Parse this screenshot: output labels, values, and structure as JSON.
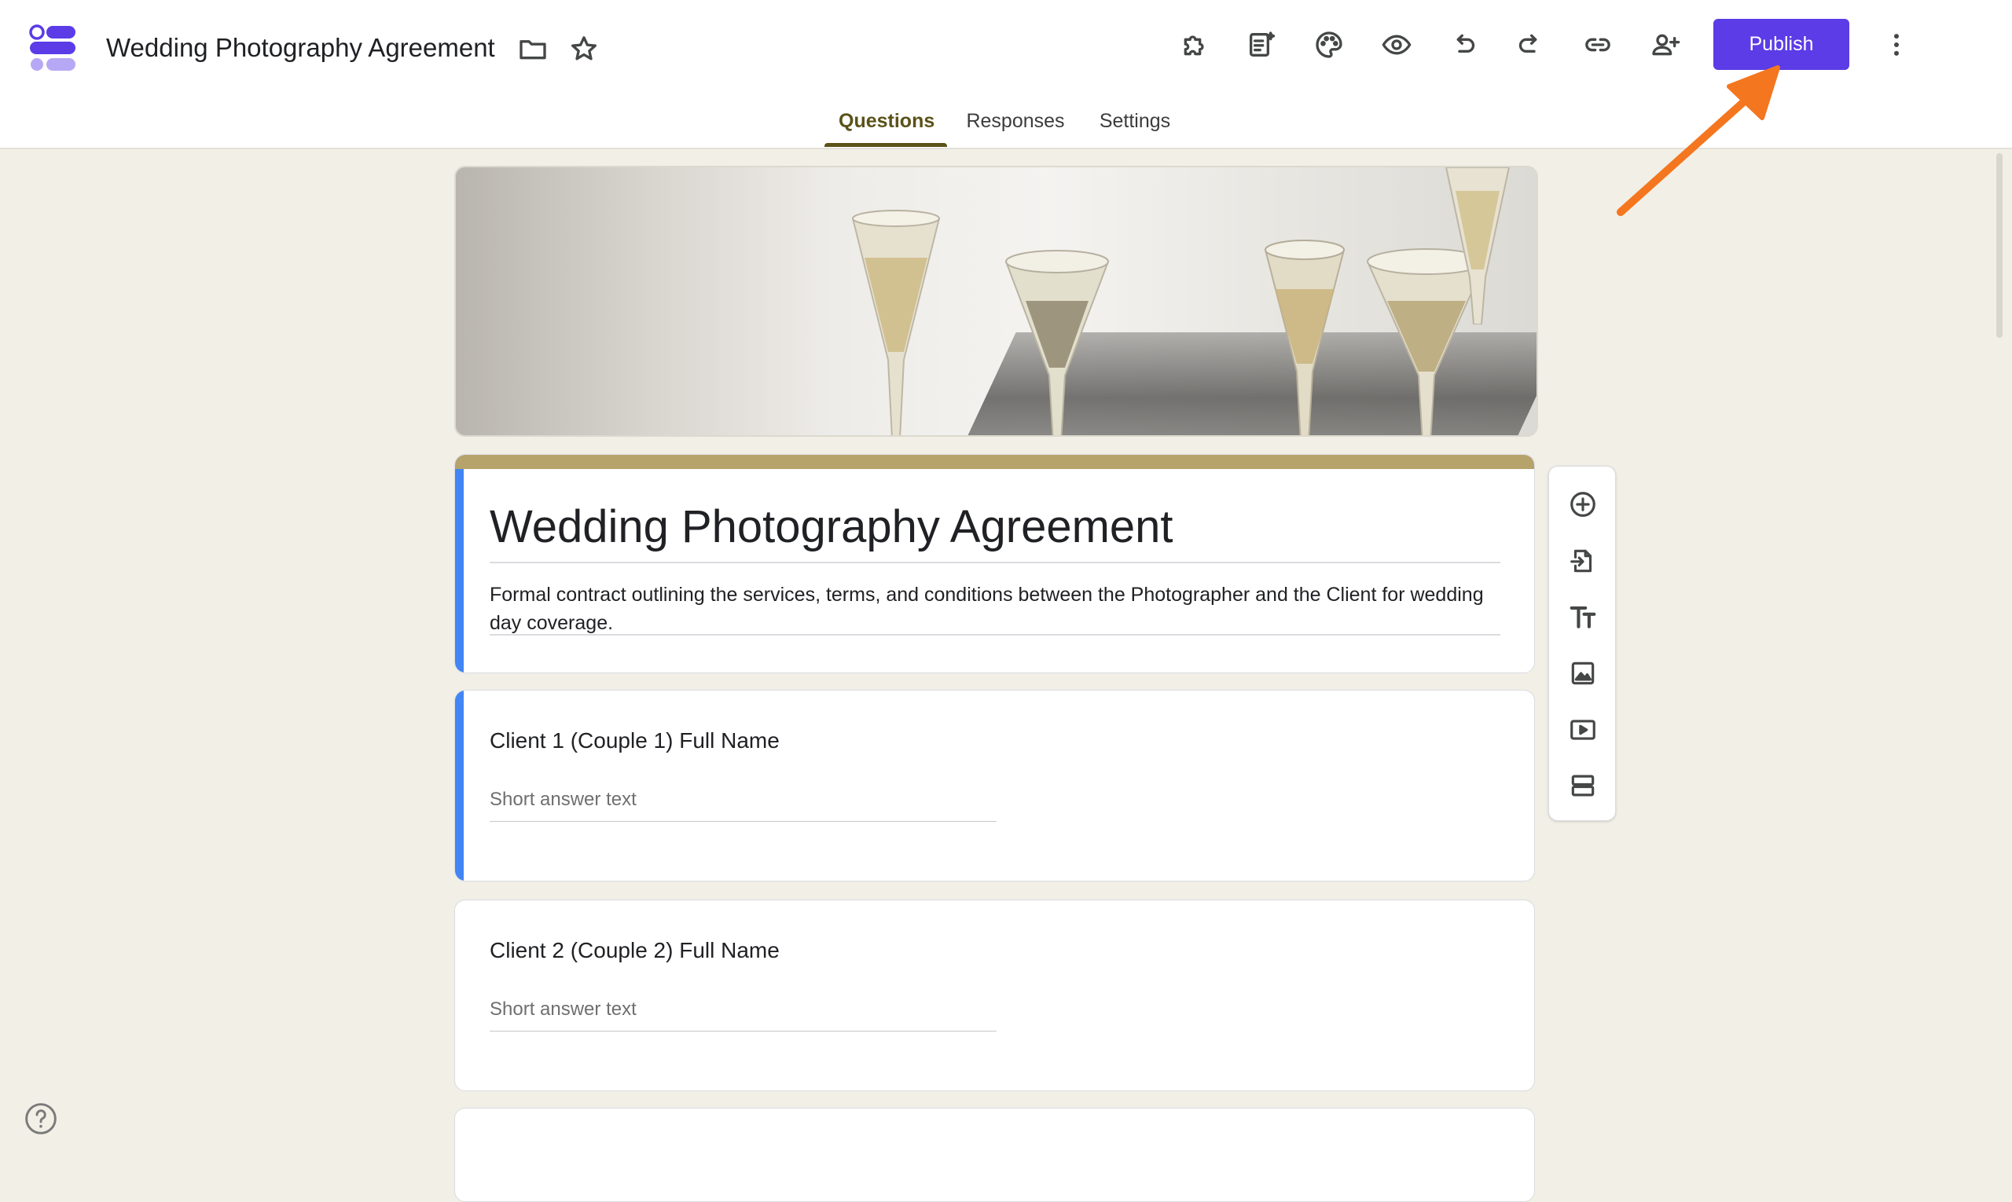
{
  "header": {
    "doc_title": "Wedding Photography Agreement",
    "publish_label": "Publish",
    "accent_color": "#5b3ce6",
    "icons": [
      "folder-icon",
      "star-icon",
      "addons-icon",
      "ai-icon",
      "palette-icon",
      "preview-icon",
      "undo-icon",
      "redo-icon",
      "link-icon",
      "add-collaborator-icon",
      "more-vert-icon"
    ]
  },
  "tabs": [
    {
      "label": "Questions",
      "active": true
    },
    {
      "label": "Responses",
      "active": false
    },
    {
      "label": "Settings",
      "active": false
    }
  ],
  "form": {
    "title": "Wedding Photography Agreement",
    "description": "Formal contract outlining the services, terms, and conditions between the Photographer and the Client for wedding day coverage.",
    "theme_color": "#b5a36b",
    "questions": [
      {
        "title": "Client 1 (Couple 1) Full Name",
        "placeholder": "Short answer text"
      },
      {
        "title": "Client 2 (Couple 2) Full Name",
        "placeholder": "Short answer text"
      }
    ]
  },
  "toolbar": {
    "buttons": [
      "add-question-icon",
      "import-questions-icon",
      "add-title-icon",
      "add-image-icon",
      "add-video-icon",
      "add-section-icon"
    ]
  },
  "annotation": {
    "arrow_color": "#f4761f"
  }
}
